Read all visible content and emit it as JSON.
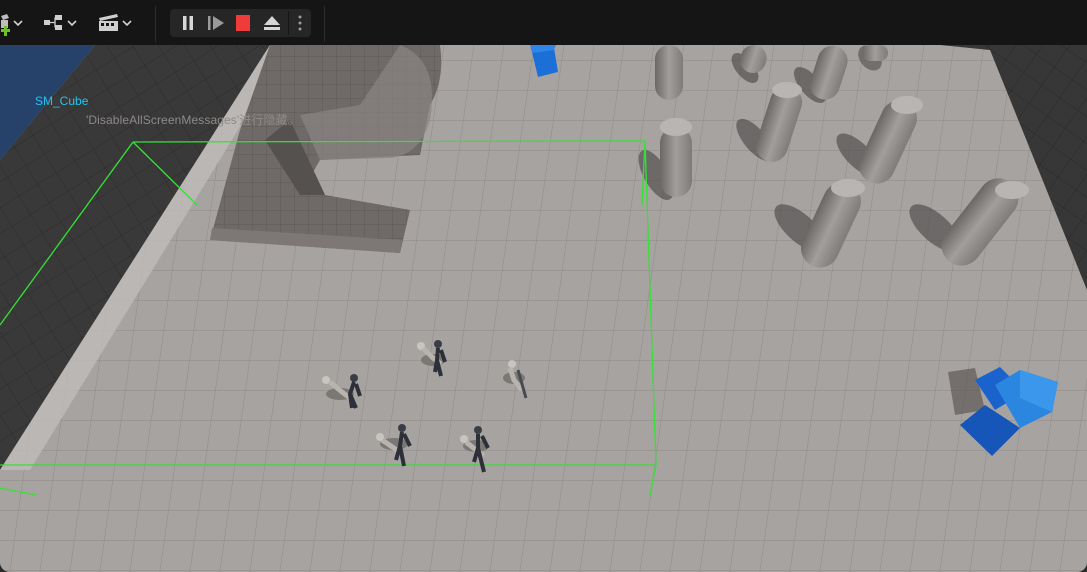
{
  "toolbar": {
    "add_icon": "add-actor-icon",
    "blueprint_icon": "blueprint-icon",
    "cinematics_icon": "clapperboard-icon",
    "play_controls": {
      "pause": "pause-icon",
      "step": "frame-advance-icon",
      "stop": "stop-icon",
      "eject": "eject-icon",
      "more": "more-options-icon"
    },
    "colors": {
      "stop": "#f03b3b",
      "add": "#6fbf2a"
    }
  },
  "viewport": {
    "selected_actor_label": "SM_Cube",
    "debug_message": "'DisableAllScreenMessages'进行隐藏。",
    "colors": {
      "selection": "#34e234",
      "cube": "#1c6fd6",
      "floor": "#a5a19f"
    }
  }
}
